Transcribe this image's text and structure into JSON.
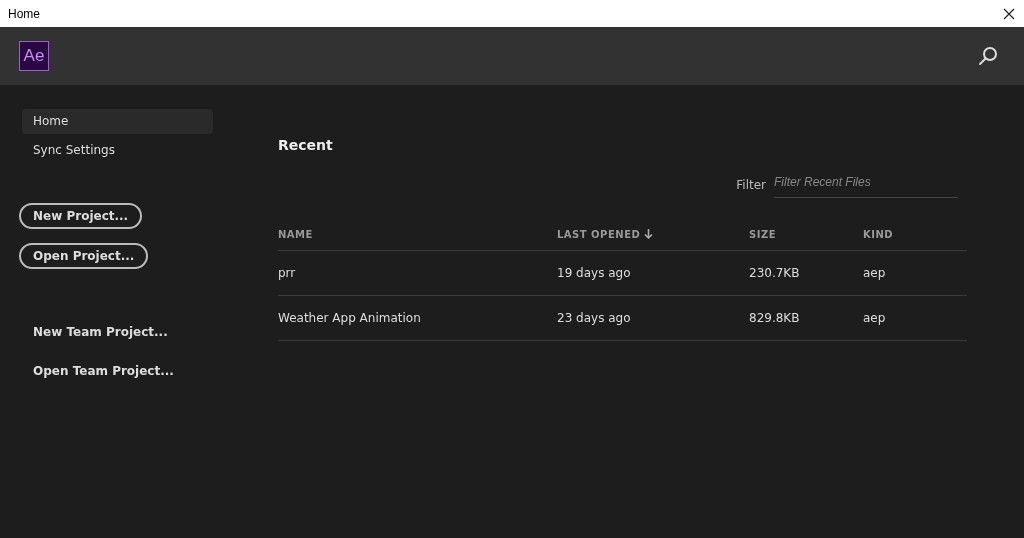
{
  "window": {
    "title": "Home"
  },
  "header": {
    "logo": "Ae"
  },
  "sidebar": {
    "items": [
      {
        "label": "Home",
        "selected": true
      },
      {
        "label": "Sync Settings",
        "selected": false
      }
    ],
    "buttons": [
      "New Project...",
      "Open Project..."
    ],
    "links": [
      "New Team Project...",
      "Open Team Project..."
    ]
  },
  "recent": {
    "title": "Recent",
    "filter": {
      "label": "Filter",
      "placeholder": "Filter Recent Files"
    },
    "table": {
      "columns": [
        {
          "label": "NAME",
          "sorted": false
        },
        {
          "label": "LAST OPENED",
          "sorted": true
        },
        {
          "label": "SIZE",
          "sorted": false
        },
        {
          "label": "KIND",
          "sorted": false
        }
      ],
      "rows": [
        [
          "prr",
          "19 days ago",
          "230.7KB",
          "aep"
        ],
        [
          "Weather App Animation",
          "23 days ago",
          "829.8KB",
          "aep"
        ]
      ]
    }
  }
}
